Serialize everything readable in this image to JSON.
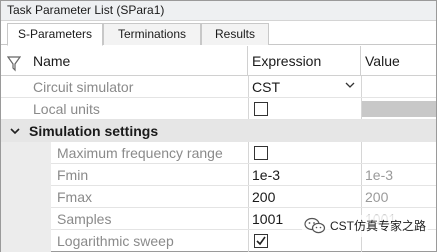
{
  "window": {
    "title": "Task Parameter List (SPara1)"
  },
  "tabs": [
    {
      "label": "S-Parameters",
      "active": true
    },
    {
      "label": "Terminations",
      "active": false
    },
    {
      "label": "Results",
      "active": false
    }
  ],
  "grid": {
    "columns": {
      "name": "Name",
      "expression": "Expression",
      "value": "Value"
    },
    "rows": {
      "circuit_simulator": {
        "name": "Circuit simulator",
        "expression": "CST"
      },
      "local_units": {
        "name": "Local units",
        "checked": false
      },
      "simulation_settings": {
        "name": "Simulation settings",
        "expanded": true
      },
      "max_freq_range": {
        "name": "Maximum frequency range",
        "checked": false
      },
      "fmin": {
        "name": "Fmin",
        "expression": "1e-3",
        "value": "1e-3"
      },
      "fmax": {
        "name": "Fmax",
        "expression": "200",
        "value": "200"
      },
      "samples": {
        "name": "Samples",
        "expression": "1001",
        "value": "1001"
      },
      "log_sweep": {
        "name": "Logarithmic sweep",
        "checked": true
      }
    }
  },
  "watermark": {
    "text": "CST仿真专家之路"
  },
  "colors": {
    "disabled_text": "#8a8a8a",
    "section_bg": "#e6e6e6",
    "value_disabled": "#c8c8c8"
  },
  "icons": {
    "filter": "funnel-icon",
    "collapse": "chevron-down-icon",
    "dropdown": "chevron-down-icon",
    "check": "checkmark-icon",
    "wechat": "wechat-icon"
  }
}
